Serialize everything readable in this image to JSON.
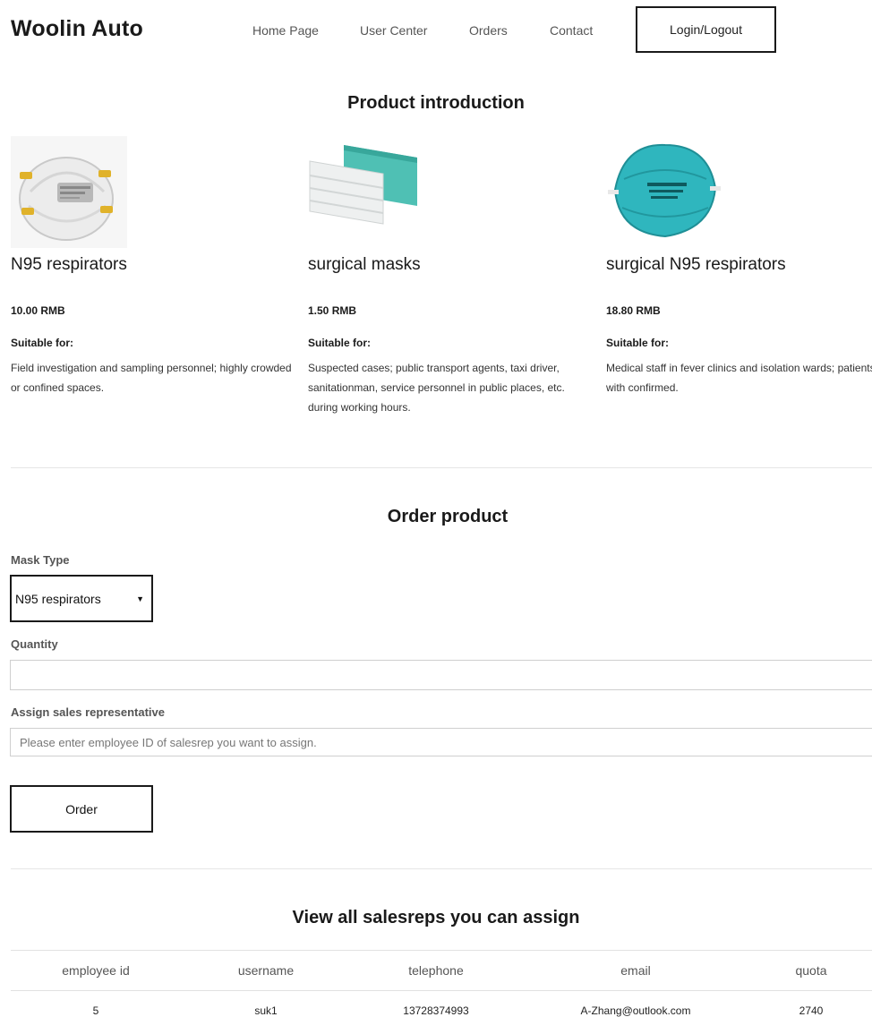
{
  "header": {
    "brand": "Woolin Auto",
    "nav": [
      "Home Page",
      "User Center",
      "Orders",
      "Contact"
    ],
    "login_label": "Login/Logout"
  },
  "intro": {
    "title": "Product introduction",
    "products": [
      {
        "name": "N95 respirators",
        "price": "10.00 RMB",
        "suitable_label": "Suitable for:",
        "description": "Field investigation and sampling personnel; highly crowded or confined spaces."
      },
      {
        "name": "surgical masks",
        "price": "1.50 RMB",
        "suitable_label": "Suitable for:",
        "description": "Suspected cases; public transport agents, taxi driver, sanitationman, service personnel in public places, etc. during working hours."
      },
      {
        "name": "surgical N95 respirators",
        "price": "18.80 RMB",
        "suitable_label": "Suitable for:",
        "description": "Medical staff in fever clinics and isolation wards; patients with confirmed."
      }
    ]
  },
  "order": {
    "title": "Order product",
    "mask_type_label": "Mask Type",
    "mask_type_value": "N95 respirators",
    "quantity_label": "Quantity",
    "quantity_value": "",
    "salesrep_label": "Assign sales representative",
    "salesrep_placeholder": "Please enter employee ID of salesrep you want to assign.",
    "order_button": "Order"
  },
  "salesreps": {
    "title": "View all salesreps you can assign",
    "columns": [
      "employee id",
      "username",
      "telephone",
      "email",
      "quota"
    ],
    "rows": [
      [
        "5",
        "suk1",
        "13728374993",
        "A-Zhang@outlook.com",
        "2740"
      ]
    ]
  }
}
